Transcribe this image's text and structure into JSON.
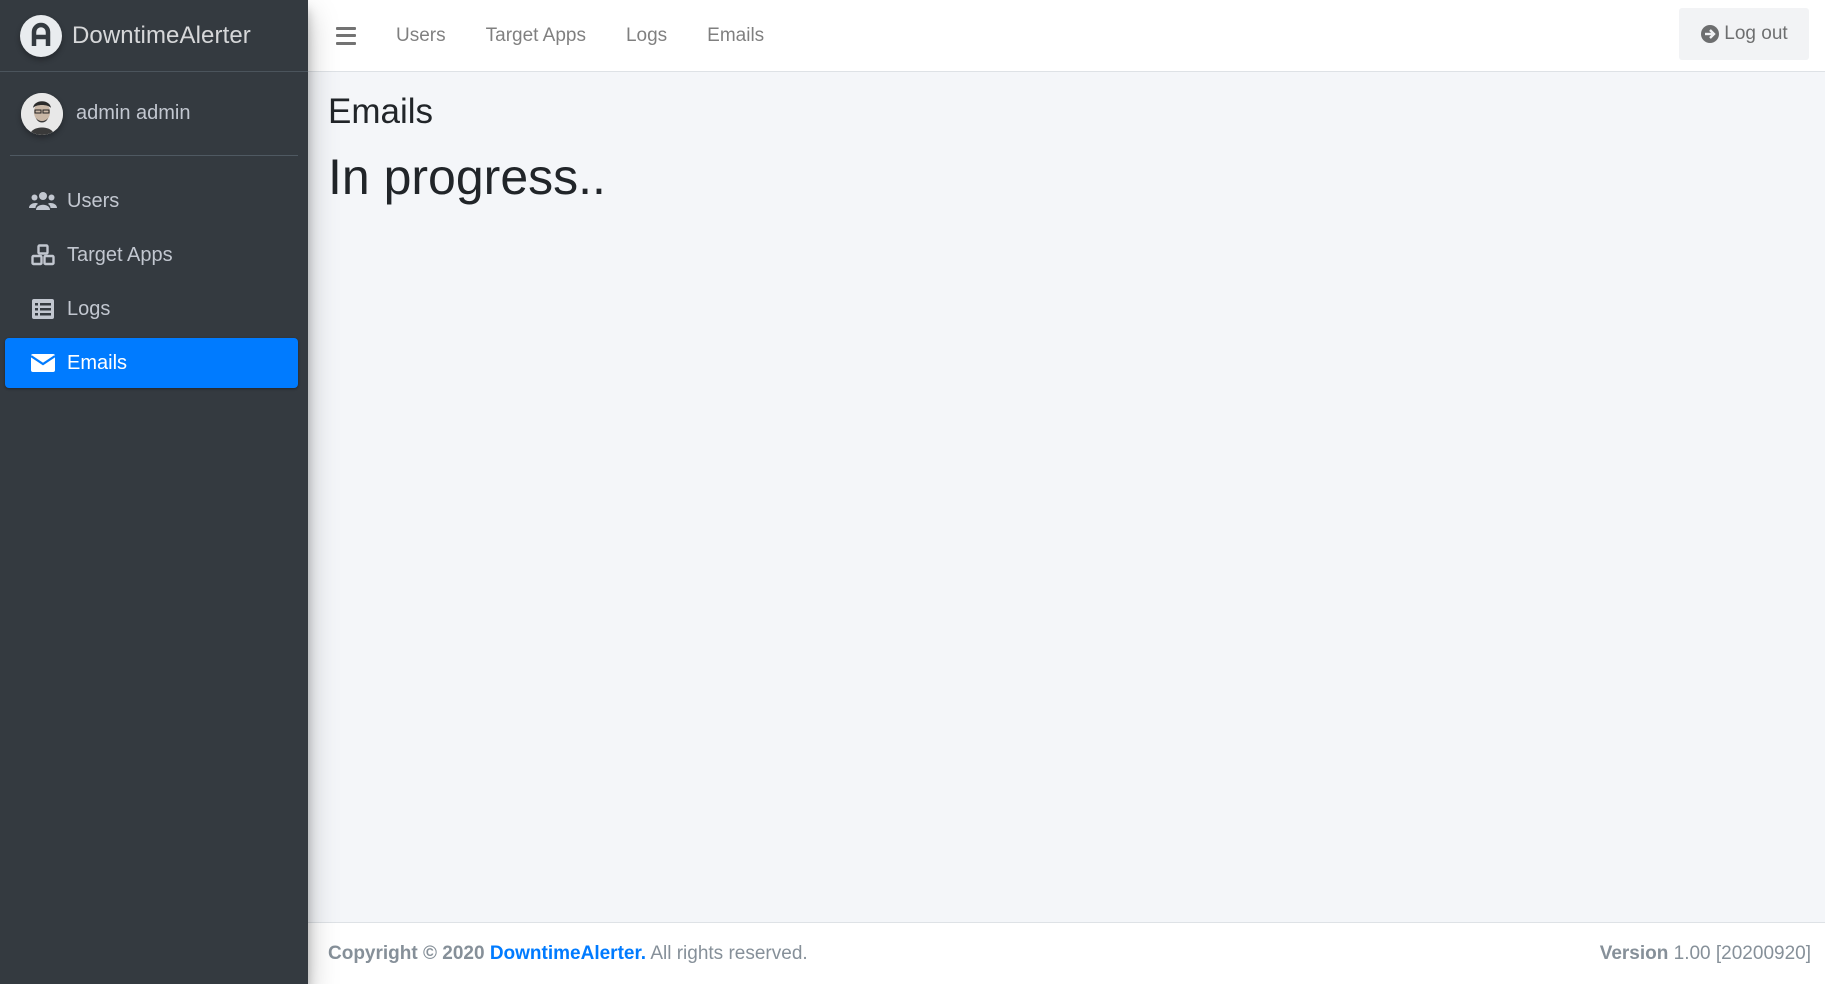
{
  "brand": {
    "name": "DowntimeAlerter",
    "logo_icon": "brand-logo-icon"
  },
  "user": {
    "name": "admin admin",
    "avatar_icon": "user-avatar"
  },
  "sidebar": {
    "items": [
      {
        "label": "Users",
        "icon": "users-icon",
        "active": false
      },
      {
        "label": "Target Apps",
        "icon": "cubes-icon",
        "active": false
      },
      {
        "label": "Logs",
        "icon": "list-icon",
        "active": false
      },
      {
        "label": "Emails",
        "icon": "envelope-icon",
        "active": true
      }
    ],
    "active_color": "#007bff"
  },
  "topnav": {
    "links": [
      "Users",
      "Target Apps",
      "Logs",
      "Emails"
    ],
    "logout_label": "Log out"
  },
  "main": {
    "title": "Emails",
    "status": "In progress.."
  },
  "footer": {
    "copyright_prefix": "Copyright © 2020",
    "brand_link": "DowntimeAlerter.",
    "rights": "All rights reserved.",
    "version_label": "Version",
    "version_value": "1.00 [20200920]"
  }
}
